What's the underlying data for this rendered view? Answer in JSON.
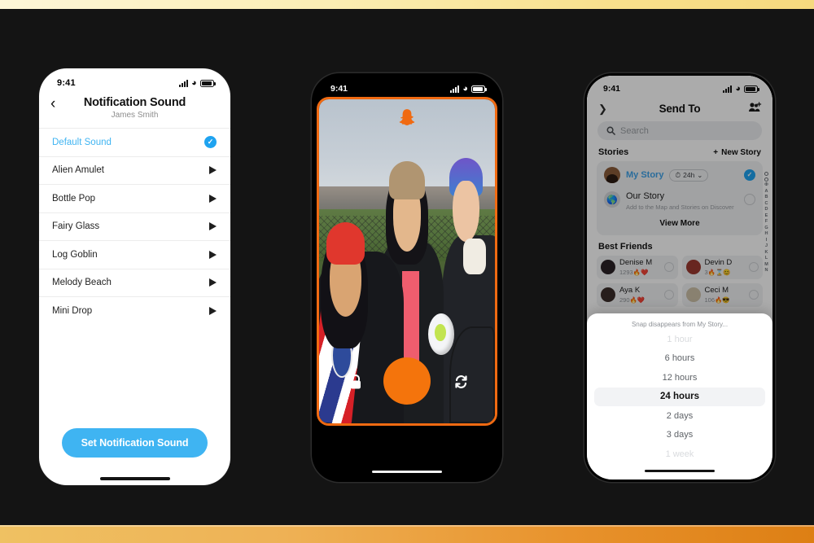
{
  "phone_sound": {
    "status_bar": {
      "time": "9:41"
    },
    "back_icon": "‹",
    "title": "Notification Sound",
    "subtitle": "James Smith",
    "sounds": [
      {
        "label": "Default Sound",
        "selected": true
      },
      {
        "label": "Alien Amulet",
        "selected": false
      },
      {
        "label": "Bottle Pop",
        "selected": false
      },
      {
        "label": "Fairy Glass",
        "selected": false
      },
      {
        "label": "Log Goblin",
        "selected": false
      },
      {
        "label": "Melody Beach",
        "selected": false
      },
      {
        "label": "Mini Drop",
        "selected": false
      }
    ],
    "cta_label": "Set Notification Sound",
    "accent_color": "#3FB4F2",
    "check_color": "#1FA3F0"
  },
  "phone_camera": {
    "status_bar": {
      "time": "9:41"
    },
    "frame_color": "#F06A12",
    "shutter_color": "#F4740C",
    "ghost_icon": "snapchat-ghost-icon",
    "lock_icon": "lock-icon",
    "flip_icon": "camera-flip-icon"
  },
  "phone_send": {
    "status_bar": {
      "time": "9:41"
    },
    "chevron_icon": "chevron-down-icon",
    "title": "Send To",
    "add_friends_icon": "add-friends-icon",
    "search": {
      "placeholder": "Search",
      "icon": "search-icon"
    },
    "stories": {
      "section_title": "Stories",
      "new_story_label": "New Story",
      "new_story_icon": "plus-icon",
      "my_story": {
        "label": "My Story",
        "duration_chip": "24h",
        "clock_icon": "clock-icon",
        "selected": true
      },
      "our_story": {
        "label": "Our Story",
        "subtitle": "Add to the Map and Stories on Discover",
        "selected": false
      },
      "view_more_label": "View More"
    },
    "best_friends": {
      "section_title": "Best Friends",
      "friends": [
        {
          "name": "Denise M",
          "meta": "1293🔥❤️"
        },
        {
          "name": "Devin D",
          "meta": "3🔥⌛😊"
        },
        {
          "name": "Aya K",
          "meta": "290🔥❤️"
        },
        {
          "name": "Ceci M",
          "meta": "106🔥😎"
        }
      ]
    },
    "alpha_index": [
      "A",
      "B",
      "C",
      "D",
      "E",
      "F",
      "G",
      "H",
      "I",
      "J",
      "K",
      "L",
      "M",
      "N"
    ],
    "duration_sheet": {
      "title": "Snap disappears from My Story...",
      "options": [
        {
          "label": "1 hour",
          "state": "faded"
        },
        {
          "label": "6 hours",
          "state": "normal"
        },
        {
          "label": "12 hours",
          "state": "normal"
        },
        {
          "label": "24 hours",
          "state": "active"
        },
        {
          "label": "2 days",
          "state": "normal"
        },
        {
          "label": "3 days",
          "state": "normal"
        },
        {
          "label": "1 week",
          "state": "faded"
        }
      ]
    }
  }
}
